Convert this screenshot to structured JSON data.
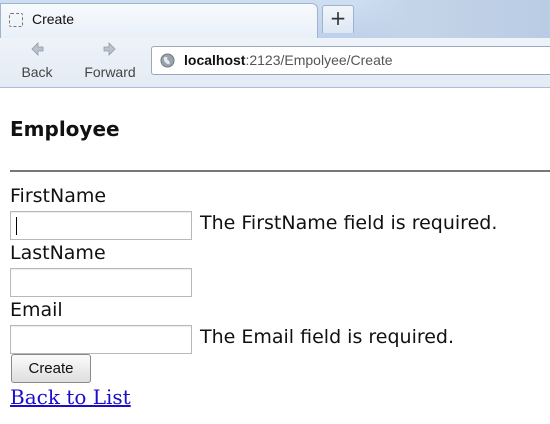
{
  "browser": {
    "tab_title": "Create",
    "new_tab_label": "+",
    "nav": {
      "back_label": "Back",
      "forward_label": "Forward"
    },
    "url": {
      "host": "localhost",
      "rest": ":2123/Empolyee/Create"
    }
  },
  "page": {
    "heading": "Employee",
    "fields": [
      {
        "label": "FirstName",
        "value": "",
        "error": "The FirstName field is required."
      },
      {
        "label": "LastName",
        "value": "",
        "error": ""
      },
      {
        "label": "Email",
        "value": "",
        "error": "The Email field is required."
      }
    ],
    "submit_label": "Create",
    "back_link": "Back to List"
  },
  "colors": {
    "link": "#1a0dcc",
    "divider": "#777777",
    "chrome": "#cfdff2"
  },
  "icons": [
    "page-icon",
    "back-arrow-icon",
    "forward-arrow-icon",
    "globe-icon"
  ]
}
